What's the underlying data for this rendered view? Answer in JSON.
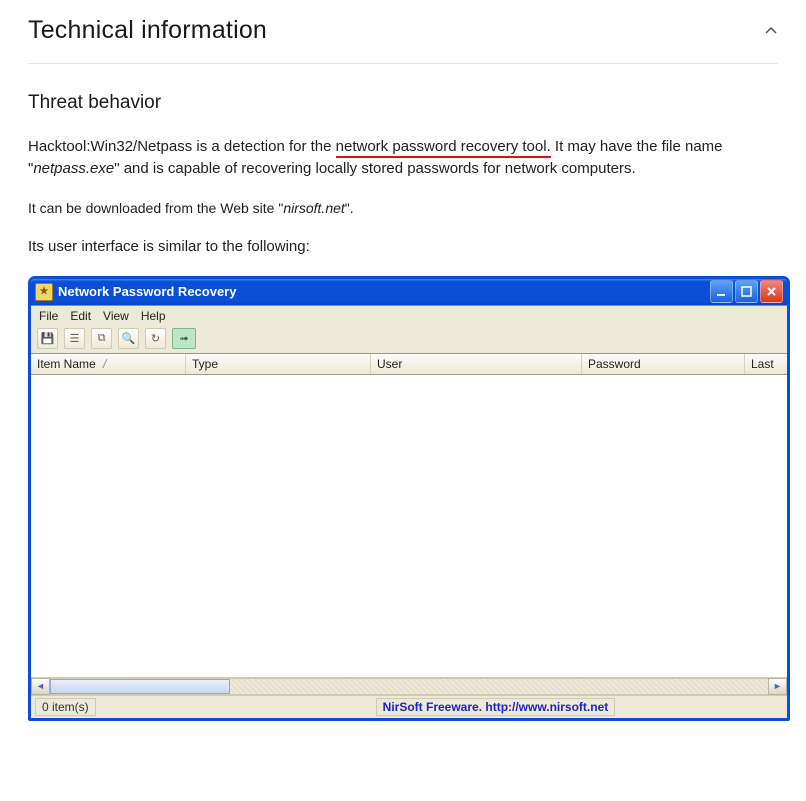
{
  "header": {
    "title": "Technical information"
  },
  "body": {
    "subhead": "Threat behavior",
    "p1a": "Hacktool:Win32/Netpass is a detection for the ",
    "p1_underlined": "network password recovery tool.",
    "p1b": " It may have the file name \"",
    "p1_em": "netpass.exe",
    "p1c": "\" and is capable of recovering locally stored passwords for network computers.",
    "p2a": "It can be downloaded from the Web site \"",
    "p2_em": "nirsoft.net",
    "p2b": "\".",
    "p3": "Its user interface is similar to the following:"
  },
  "xp": {
    "title": "Network Password Recovery",
    "menu": {
      "file": "File",
      "edit": "Edit",
      "view": "View",
      "help": "Help"
    },
    "columns": {
      "item": "Item Name",
      "sort": "/",
      "type": "Type",
      "user": "User",
      "password": "Password",
      "last": "Last"
    },
    "status": {
      "count": "0 item(s)",
      "credit": "NirSoft Freeware.  http://www.nirsoft.net"
    }
  }
}
